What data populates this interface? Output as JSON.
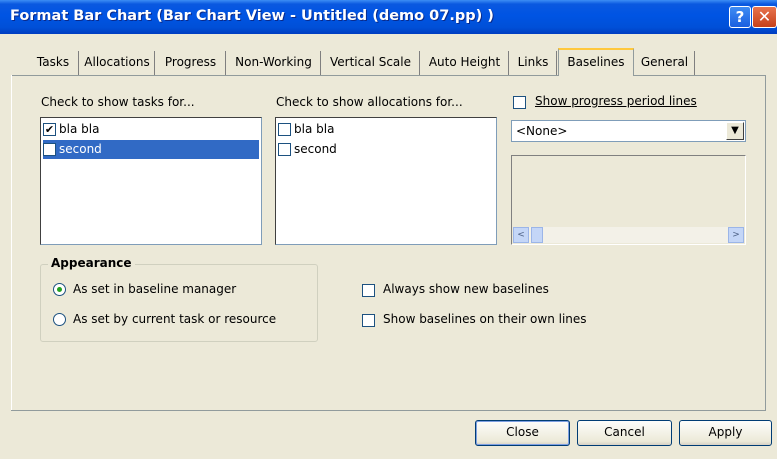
{
  "window": {
    "title": "Format Bar Chart (Bar Chart View - Untitled (demo 07.pp) )",
    "help_glyph": "?",
    "close_glyph": "✕",
    "title_color": "#0054e3"
  },
  "tabs": [
    {
      "label": "Tasks",
      "active": false
    },
    {
      "label": "Allocations",
      "active": false
    },
    {
      "label": "Progress",
      "active": false
    },
    {
      "label": "Non-Working",
      "active": false
    },
    {
      "label": "Vertical Scale",
      "active": false
    },
    {
      "label": "Auto Height",
      "active": false
    },
    {
      "label": "Links",
      "active": false
    },
    {
      "label": "Baselines",
      "active": true
    },
    {
      "label": "General",
      "active": false
    }
  ],
  "tasks_panel": {
    "label": "Check to show tasks for...",
    "items": [
      {
        "text": "bla bla",
        "checked": true,
        "selected": false
      },
      {
        "text": "second",
        "checked": false,
        "selected": true
      }
    ]
  },
  "allocations_panel": {
    "label": "Check to show allocations for...",
    "items": [
      {
        "text": "bla bla",
        "checked": false
      },
      {
        "text": "second",
        "checked": false
      }
    ]
  },
  "progress": {
    "show_label": "Show progress period lines",
    "checked": false,
    "combo_value": "<None>",
    "combo_icon": "chevron-down-icon",
    "scroll_left_glyph": "<",
    "scroll_right_glyph": ">"
  },
  "appearance": {
    "title": "Appearance",
    "options": [
      {
        "label": "As set in baseline manager",
        "selected": true
      },
      {
        "label": "As set by current task or resource",
        "selected": false
      }
    ]
  },
  "baseline_options": {
    "always_show_new": {
      "label": "Always show new baselines",
      "checked": false
    },
    "own_lines": {
      "label": "Show baselines on their own lines",
      "checked": false
    }
  },
  "buttons": {
    "close": "Close",
    "cancel": "Cancel",
    "apply": "Apply"
  },
  "colors": {
    "selection": "#316ac5",
    "face": "#ece9d8"
  }
}
